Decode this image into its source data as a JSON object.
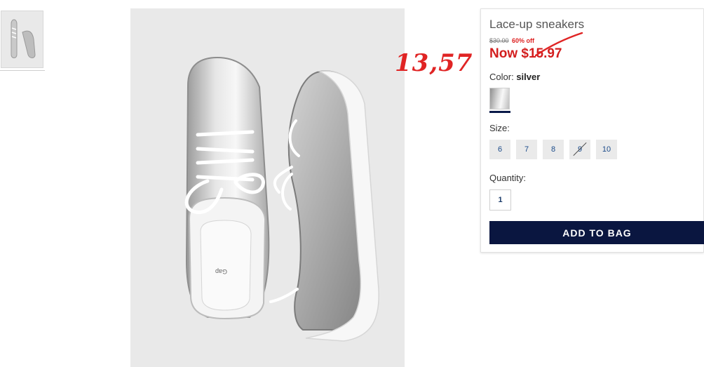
{
  "gallery": {
    "thumbnails": [
      {
        "icon": "sneaker-thumbnail-image"
      }
    ],
    "main_image_icon": "silver-sneakers-photo",
    "insole_brand": "Gap"
  },
  "annotation": {
    "text": "13,57",
    "color": "#e02424"
  },
  "product": {
    "title": "Lace-up sneakers",
    "was_price": "$30.00",
    "discount": "60% off",
    "now_price": "Now $15.97",
    "color_label": "Color:",
    "color_value": "silver",
    "size_label": "Size:",
    "sizes": [
      {
        "label": "6",
        "available": true
      },
      {
        "label": "7",
        "available": true
      },
      {
        "label": "8",
        "available": true
      },
      {
        "label": "9",
        "available": false
      },
      {
        "label": "10",
        "available": true
      }
    ],
    "quantity_label": "Quantity:",
    "quantity_value": "1",
    "add_to_bag_label": "ADD TO BAG"
  },
  "colors": {
    "brand_navy": "#0a1640",
    "sale_red": "#d31e1e",
    "link_blue": "#1b4b8a"
  }
}
